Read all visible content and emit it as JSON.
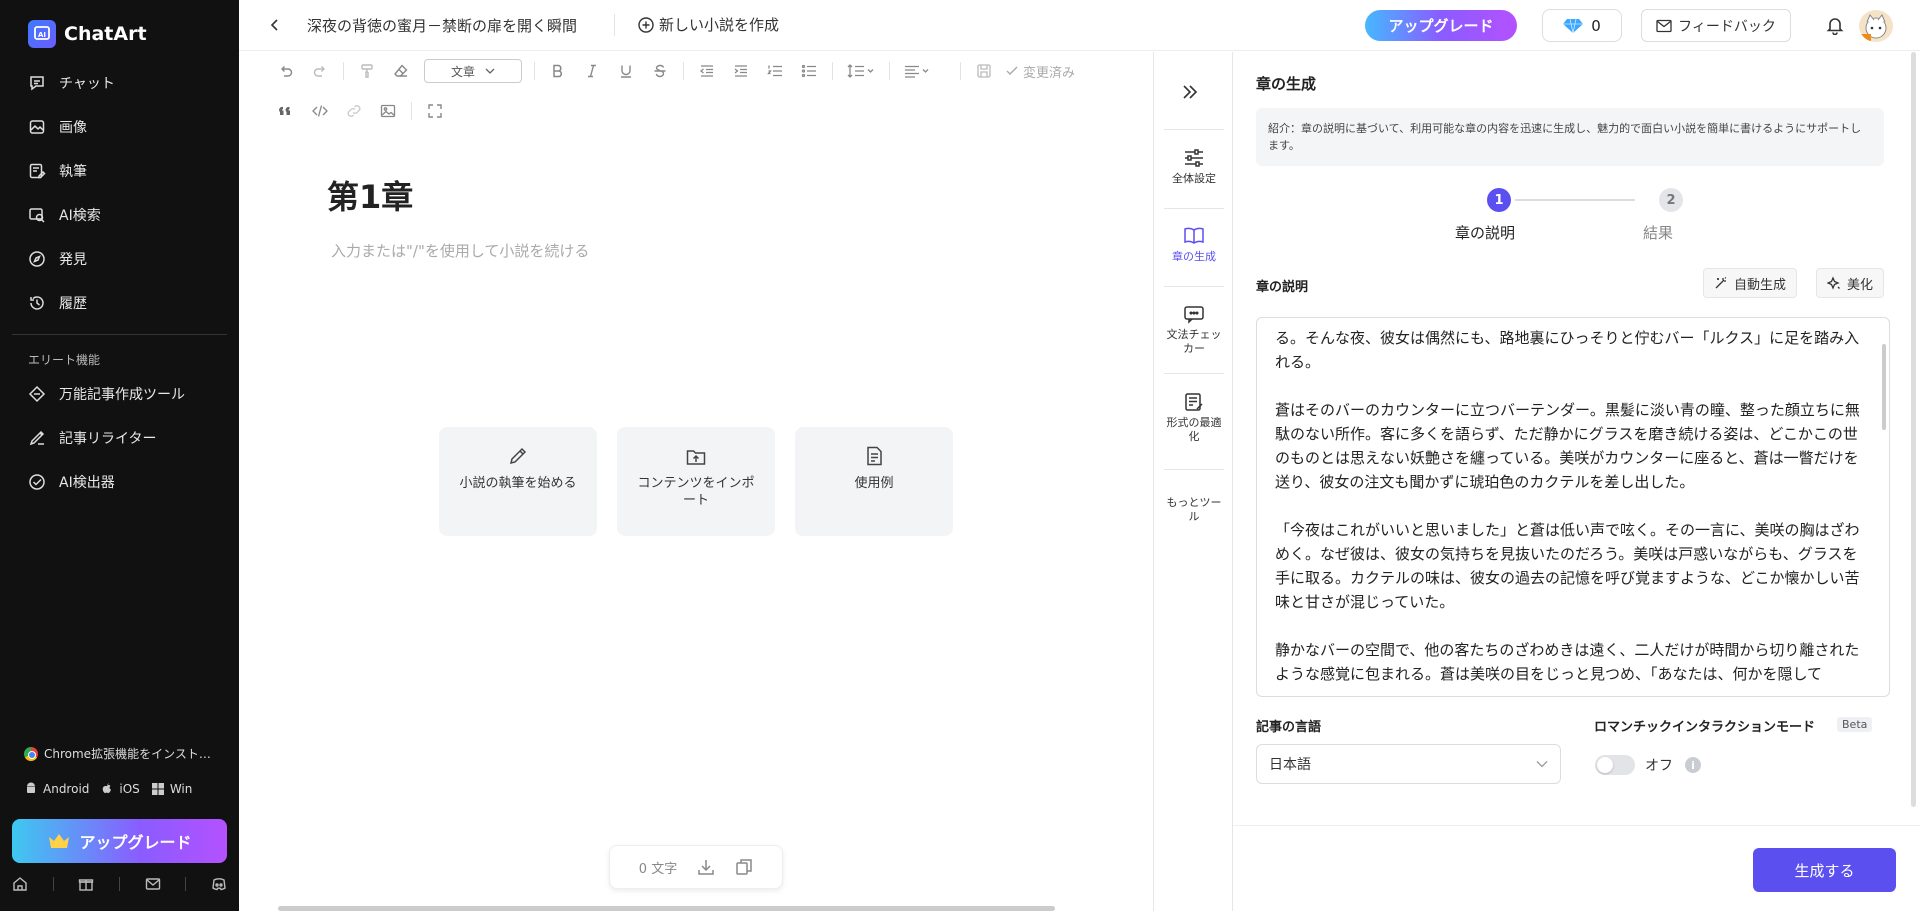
{
  "app": {
    "name": "ChatArt",
    "accent": "#5b4ff0"
  },
  "sidebar": {
    "items": [
      {
        "label": "チャット",
        "icon": "chat-icon"
      },
      {
        "label": "画像",
        "icon": "image-icon"
      },
      {
        "label": "執筆",
        "icon": "write-icon"
      },
      {
        "label": "AI検索",
        "icon": "ai-search-icon"
      },
      {
        "label": "発見",
        "icon": "compass-icon"
      },
      {
        "label": "履歴",
        "icon": "history-icon"
      }
    ],
    "section_label": "エリート機能",
    "elite_items": [
      {
        "label": "万能記事作成ツール",
        "icon": "universal-writer-icon"
      },
      {
        "label": "記事リライター",
        "icon": "rewriter-icon"
      },
      {
        "label": "AI検出器",
        "icon": "ai-detector-icon"
      }
    ],
    "extension_label": "Chrome拡張機能をインスト…",
    "platforms": [
      "Android",
      "iOS",
      "Win"
    ],
    "upgrade_label": "アップグレード"
  },
  "topbar": {
    "doc_title": "深夜の背徳の蜜月－禁断の扉を開く瞬間",
    "new_novel_label": "新しい小説を作成",
    "upgrade_label": "アップグレード",
    "gems_count": "0",
    "feedback_label": "フィードバック"
  },
  "editor": {
    "style_select": "文章",
    "saved_label": "変更済み",
    "chapter_title": "第1章",
    "placeholder": "入力または\"/\"を使用して小説を続ける",
    "cards": [
      {
        "label": "小説の執筆を始める",
        "icon": "pencil-icon"
      },
      {
        "label": "コンテンツをインポート",
        "icon": "import-icon"
      },
      {
        "label": "使用例",
        "icon": "example-doc-icon"
      }
    ],
    "word_count": "0 文字"
  },
  "tools": [
    {
      "label": "全体設定",
      "icon": "sliders-icon"
    },
    {
      "label": "章の生成",
      "icon": "book-icon"
    },
    {
      "label": "文法チェッカー",
      "icon": "grammar-icon"
    },
    {
      "label": "形式の最適化",
      "icon": "format-icon"
    },
    {
      "label": "もっとツール",
      "icon": ""
    }
  ],
  "panel": {
    "title": "章の生成",
    "intro": "紹介：章の説明に基づいて、利用可能な章の内容を迅速に生成し、魅力的で面白い小説を簡単に書けるようにサポートします。",
    "steps": [
      {
        "num": "1",
        "label": "章の説明"
      },
      {
        "num": "2",
        "label": "結果"
      }
    ],
    "desc_label": "章の説明",
    "auto_generate_label": "自動生成",
    "beautify_label": "美化",
    "paragraphs": [
      "る。そんな夜、彼女は偶然にも、路地裏にひっそりと佇むバー「ルクス」に足を踏み入れる。",
      "蒼はそのバーのカウンターに立つバーテンダー。黒髪に淡い青の瞳、整った顔立ちに無駄のない所作。客に多くを語らず、ただ静かにグラスを磨き続ける姿は、どこかこの世のものとは思えない妖艶さを纏っている。美咲がカウンターに座ると、蒼は一瞥だけを送り、彼女の注文も聞かずに琥珀色のカクテルを差し出した。",
      "「今夜はこれがいいと思いました」と蒼は低い声で呟く。その一言に、美咲の胸はざわめく。なぜ彼は、彼女の気持ちを見抜いたのだろう。美咲は戸惑いながらも、グラスを手に取る。カクテルの味は、彼女の過去の記憶を呼び覚ますような、どこか懐かしい苦味と甘さが混じっていた。",
      "静かなバーの空間で、他の客たちのざわめきは遠く、二人だけが時間から切り離されたような感覚に包まれる。蒼は美咲の目をじっと見つめ、「あなたは、何かを隠して"
    ],
    "language_label": "記事の言語",
    "language_value": "日本語",
    "romance_label": "ロマンチックインタラクションモード",
    "beta_label": "Beta",
    "toggle_label": "オフ",
    "generate_label": "生成する"
  }
}
